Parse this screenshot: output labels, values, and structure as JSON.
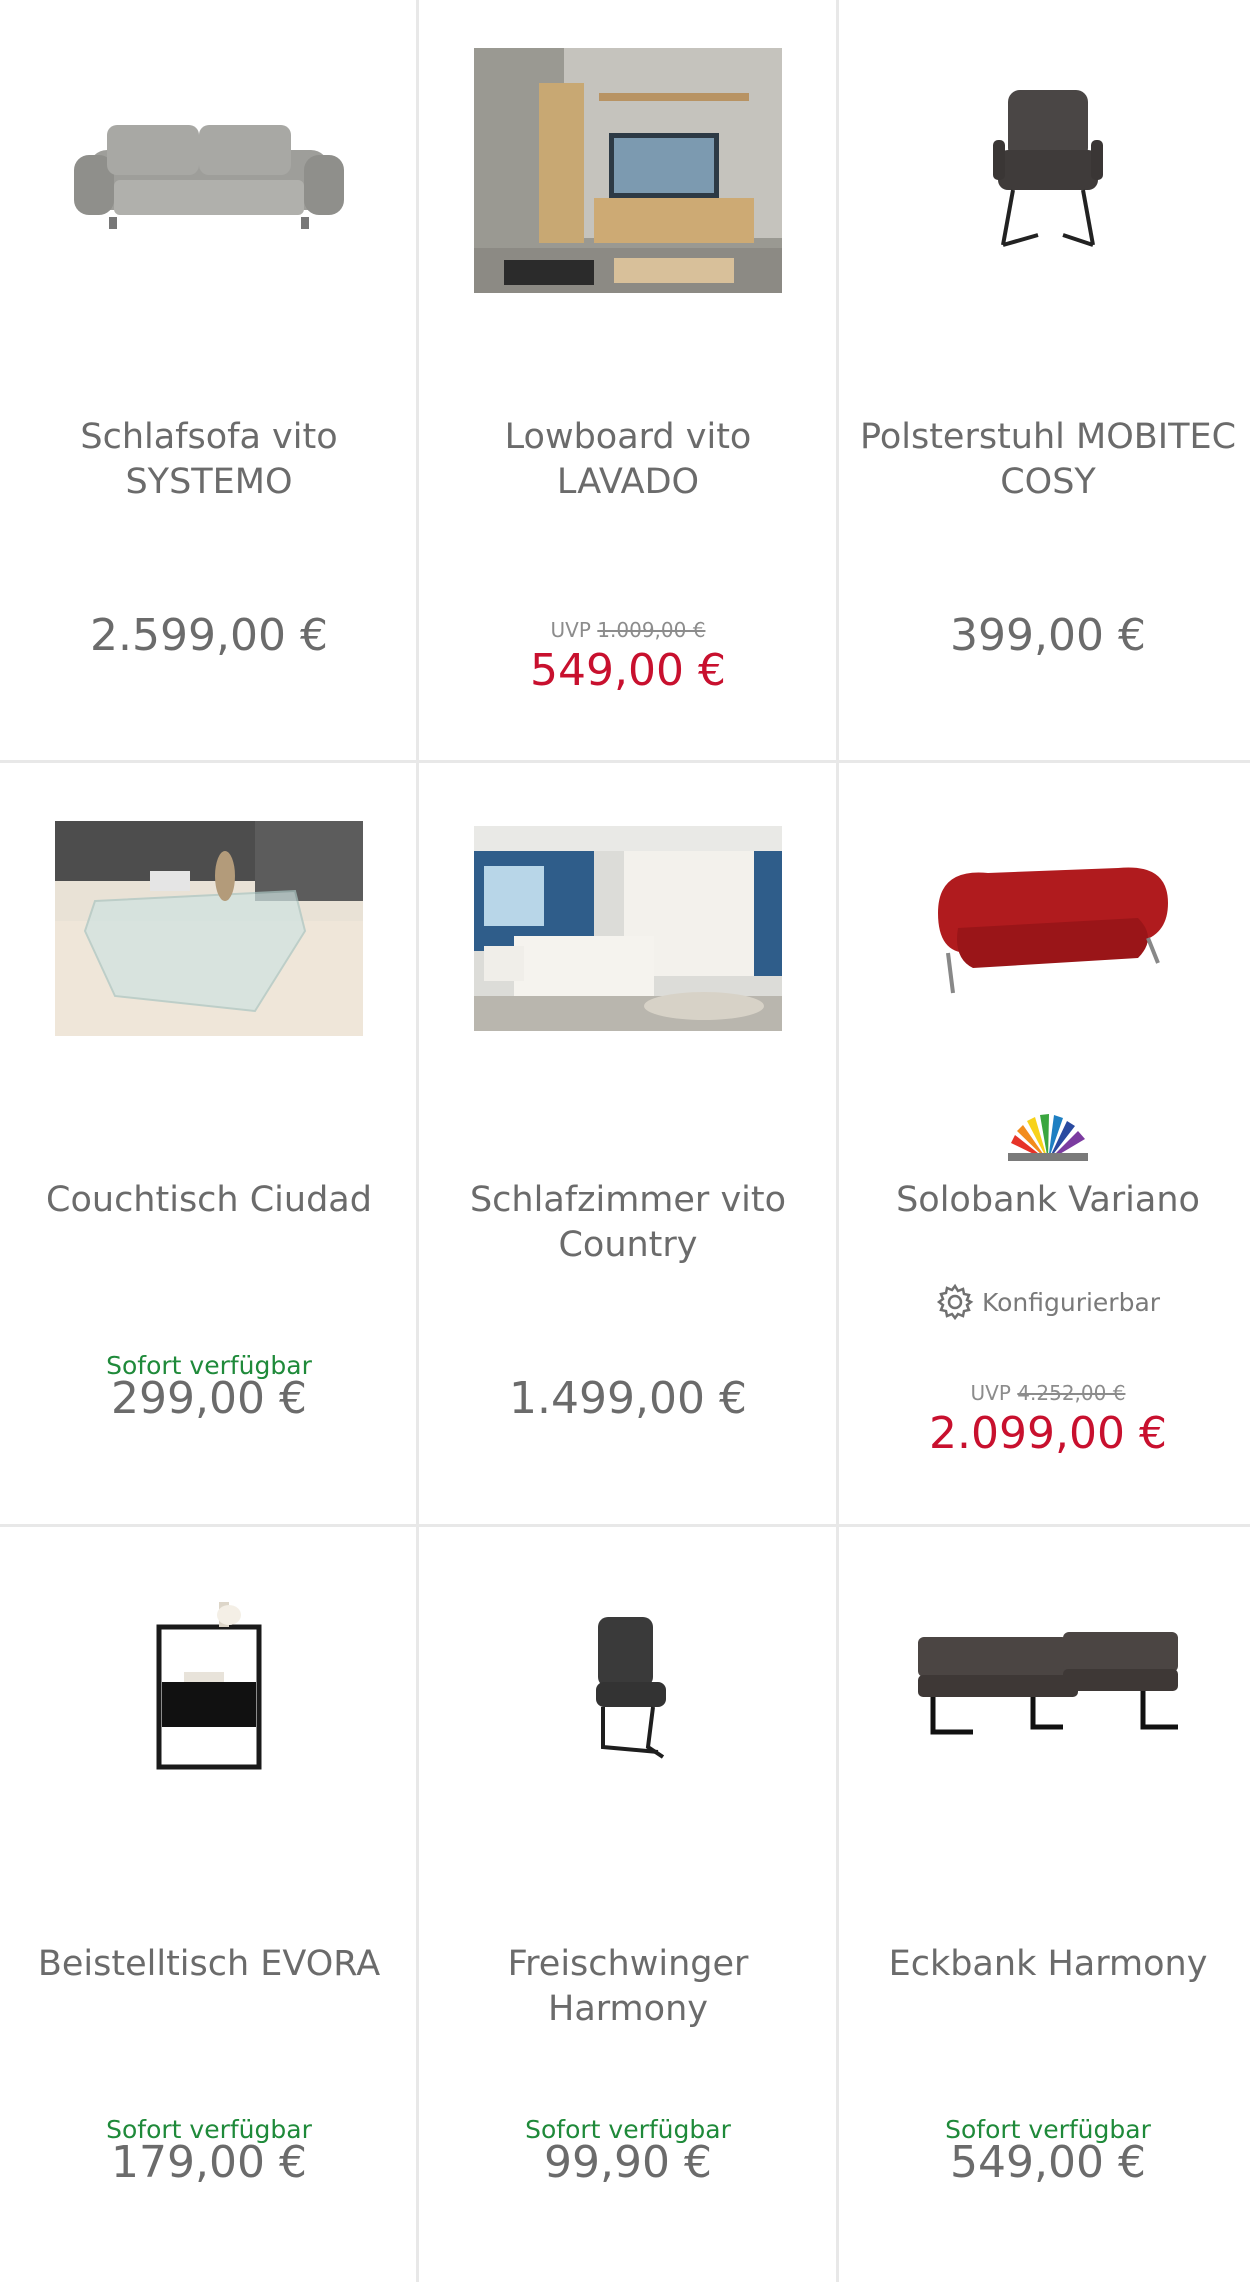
{
  "products": [
    {
      "name": "Schlafsofa vito SYSTEMO",
      "price": "2.599,00 €"
    },
    {
      "name": "Lowboard vito LAVADO",
      "uvp_label": "UVP",
      "uvp_price": "1.009,00 €",
      "sale_price": "549,00 €"
    },
    {
      "name": "Polsterstuhl MOBITEC COSY",
      "price": "399,00 €"
    },
    {
      "name": "Couchtisch Ciudad",
      "availability": "Sofort verfügbar",
      "price": "299,00 €"
    },
    {
      "name": "Schlafzimmer vito Country",
      "price": "1.499,00 €"
    },
    {
      "name": "Solobank Variano",
      "configurable": "Konfigurierbar",
      "uvp_label": "UVP",
      "uvp_price": "4.252,00 €",
      "sale_price": "2.099,00 €"
    },
    {
      "name": "Beistelltisch EVORA",
      "availability": "Sofort verfügbar",
      "price": "179,00 €"
    },
    {
      "name": "Freischwinger Harmony",
      "availability": "Sofort verfügbar",
      "price": "99,90 €"
    },
    {
      "name": "Eckbank Harmony",
      "availability": "Sofort verfügbar",
      "price": "549,00 €"
    }
  ],
  "colors": {
    "availability": "#1f8a3a",
    "sale": "#c8102e",
    "text": "#6b6b6b",
    "divider": "#e8e8e8"
  },
  "icons": [
    "sofa-image",
    "lowboard-image",
    "chair-image",
    "coffee-table-image",
    "bedroom-image",
    "red-bench-image",
    "color-swatch-icon",
    "gear-icon",
    "side-table-image",
    "cantilever-chair-image",
    "corner-bench-image"
  ]
}
